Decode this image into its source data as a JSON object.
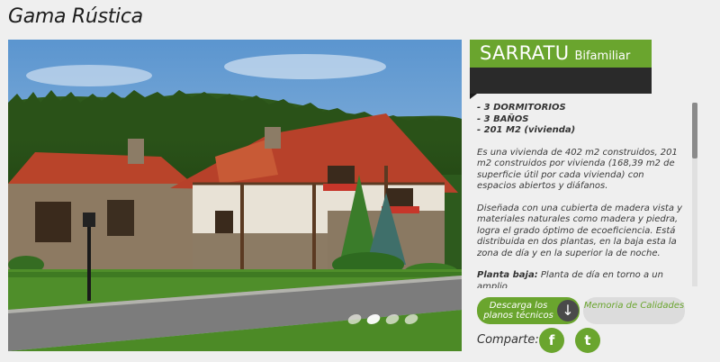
{
  "page_title": "Gama Rústica",
  "slider": {
    "slide_count": 4,
    "active_index": 1
  },
  "model": {
    "name": "SARRATU",
    "type": "Bifamiliar"
  },
  "features": [
    "- 3 DORMITORIOS",
    "- 3 BAÑOS",
    "- 201 M2 (vivienda)"
  ],
  "paragraphs": [
    "Es una vivienda de 402 m2 construidos, 201 m2 construidos por vivienda (168,39 m2 de superficie útil por cada vivienda) con espacios abiertos y diáfanos.",
    "Diseñada con una cubierta de madera vista y materiales naturales como madera y piedra, logra el grado óptimo de ecoeficiencia. Está distribuida en dos plantas, en la baja esta la zona de día y en la superior la de noche."
  ],
  "planta_baja": {
    "label": "Planta baja:",
    "text": " Planta de día en torno a un amplio"
  },
  "buttons": {
    "download": "Descarga los planos técnicos",
    "download_icon": "↓",
    "memoria": "Memoria de Calidades"
  },
  "share": {
    "label": "Comparte:",
    "facebook_icon": "f",
    "twitter_icon": "t"
  },
  "colors": {
    "accent": "#6aa52e",
    "dark": "#2a2a2a"
  }
}
